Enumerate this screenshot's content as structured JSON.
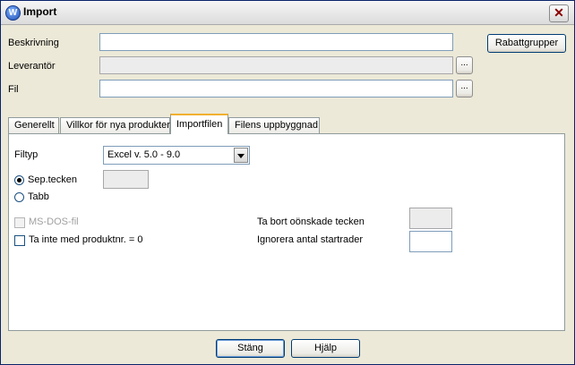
{
  "window": {
    "title": "Import",
    "app_icon_letter": "W"
  },
  "fields": {
    "beskrivning_label": "Beskrivning",
    "beskrivning_value": "",
    "leverantor_label": "Leverantör",
    "leverantor_value": "",
    "fil_label": "Fil",
    "fil_value": "",
    "browse_label": "..."
  },
  "buttons": {
    "rabattgrupper": "Rabattgrupper",
    "stang": "Stäng",
    "hjalp": "Hjälp"
  },
  "tabs": [
    {
      "label": "Generellt"
    },
    {
      "label": "Villkor för nya produkter"
    },
    {
      "label": "Importfilen",
      "active": true
    },
    {
      "label": "Filens uppbyggnad"
    }
  ],
  "importfilen": {
    "filtyp_label": "Filtyp",
    "filtyp_value": "Excel v. 5.0 - 9.0",
    "sep_label": "Sep.tecken",
    "sep_checked": true,
    "tabb_label": "Tabb",
    "msdos_label": "MS-DOS-fil",
    "ta_inte_label": "Ta inte med produktnr. = 0",
    "ta_bort_label": "Ta bort oönskade tecken",
    "ignorera_label": "Ignorera antal startrader"
  }
}
